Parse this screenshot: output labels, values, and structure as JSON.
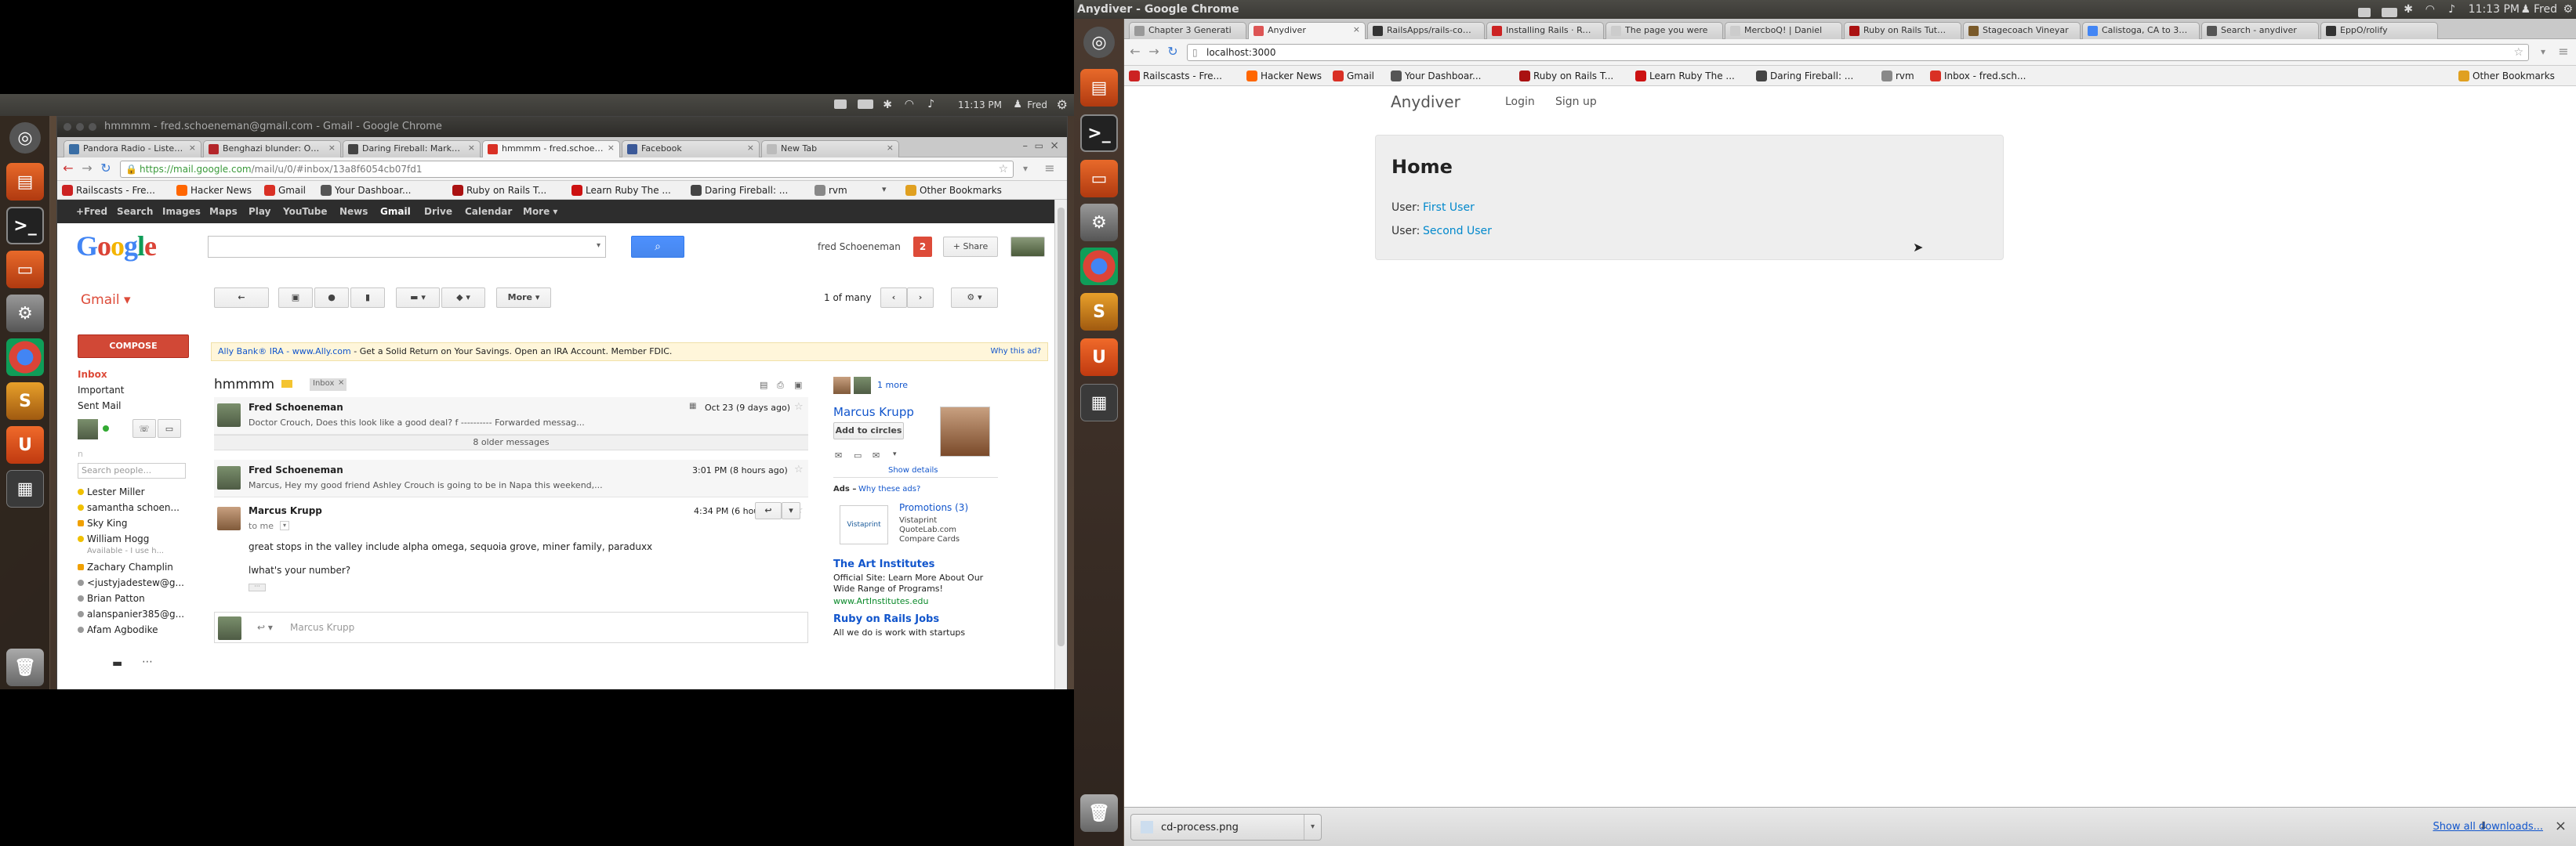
{
  "left_panel": {
    "time": "11:13 PM",
    "user": "Fred"
  },
  "gmail_window": {
    "title": "hmmmm - fred.schoeneman@gmail.com - Gmail - Google Chrome",
    "tabs": [
      {
        "label": "Pandora Radio - Listen to",
        "color": "#3a6ea5"
      },
      {
        "label": "Benghazi blunder: Obam",
        "color": "#b4262a"
      },
      {
        "label": "Daring Fireball: Markdow",
        "color": "#444444"
      },
      {
        "label": "hmmmm - fred.schoenem",
        "color": "#d93025"
      },
      {
        "label": "Facebook",
        "color": "#3b5998"
      },
      {
        "label": "New Tab",
        "color": "#bbbbbb"
      }
    ],
    "url_host": "https://mail.google.com",
    "url_path": "/mail/u/0/#inbox/13a8f6054cb07fd1",
    "bookmarks": [
      {
        "label": "Railscasts - Fre...",
        "color": "#cc2222"
      },
      {
        "label": "Hacker News",
        "color": "#ff6600"
      },
      {
        "label": "Gmail",
        "color": "#d93025"
      },
      {
        "label": "Your Dashboar...",
        "color": "#555555"
      },
      {
        "label": "Ruby on Rails T...",
        "color": "#aa1111"
      },
      {
        "label": "Learn Ruby The ...",
        "color": "#cc1111"
      },
      {
        "label": "Daring Fireball: ...",
        "color": "#444444"
      },
      {
        "label": "rvm",
        "color": "#888888"
      }
    ],
    "other_bookmarks": "Other Bookmarks"
  },
  "gmail": {
    "bar_items": [
      "+Fred",
      "Search",
      "Images",
      "Maps",
      "Play",
      "YouTube",
      "News",
      "Gmail",
      "Drive",
      "Calendar",
      "More ▾"
    ],
    "logo": "Google",
    "user_name": "fred Schoeneman",
    "notif_count": "2",
    "share_label": "+ Share",
    "gmail_label": "Gmail ▾",
    "more_label": "More ▾",
    "pagination": "1 of many",
    "compose": "COMPOSE",
    "nav": [
      "Inbox",
      "Important",
      "Sent Mail"
    ],
    "search_people": "Search people...",
    "contacts": [
      {
        "name": "Lester Miller",
        "status": "#f0c000",
        "sub": ""
      },
      {
        "name": "samantha schoen...",
        "status": "#f0c000",
        "sub": ""
      },
      {
        "name": "Sky King",
        "status": "#f0a000",
        "sub": ""
      },
      {
        "name": "William Hogg",
        "status": "#f0c000",
        "sub": "Available - I use h..."
      },
      {
        "name": "Zachary Champlin",
        "status": "#f0a000",
        "sub": ""
      },
      {
        "name": "<justyjadestew@g...",
        "status": "#999999",
        "sub": ""
      },
      {
        "name": "Brian Patton",
        "status": "#999999",
        "sub": ""
      },
      {
        "name": "alanspanier385@g...",
        "status": "#999999",
        "sub": ""
      },
      {
        "name": "Afam Agbodike",
        "status": "#999999",
        "sub": ""
      }
    ],
    "ad_sponsor": "Ally Bank® IRA - www.Ally.com",
    "ad_text": " - Get a Solid Return on Your Savings. Open an IRA Account. Member FDIC.",
    "why_ad": "Why this ad?",
    "subject": "hmmmm",
    "inbox_tag": "Inbox",
    "messages": [
      {
        "from": "Fred Schoeneman",
        "time": "Oct 23 (9 days ago)",
        "snippet": "Doctor Crouch, Does this look like a good deal? f ---------- Forwarded messag..."
      },
      {
        "from": "Fred Schoeneman",
        "time": "3:01 PM (8 hours ago)",
        "snippet": "Marcus, Hey my good friend Ashley Crouch is going to be in Napa this weekend,..."
      }
    ],
    "older": "8 older messages",
    "open_msg": {
      "from": "Marcus Krupp",
      "time": "4:34 PM (6 hours ago)",
      "to": "to me",
      "body1": "great stops in the valley include alpha omega, sequoia grove, miner family, paraduxx",
      "body2": "lwhat's your number?"
    },
    "reply_to": "Marcus Krupp",
    "side": {
      "more_people": "1 more",
      "person": "Marcus Krupp",
      "add_circles": "Add to circles",
      "show_details": "Show details",
      "ads_label": "Ads –",
      "why_ads": "Why these ads?",
      "ad1_title": "Promotions (3)",
      "ad1_lines": [
        "Vistaprint",
        "QuoteLab.com",
        "Compare Cards"
      ],
      "ad1_logo": "Vistaprint",
      "ad2_title": "The Art Institutes",
      "ad2_text": "Official Site: Learn More About Our Wide Range of Programs!",
      "ad2_url": "www.ArtInstitutes.edu",
      "ad3_title": "Ruby on Rails Jobs",
      "ad3_text": "All we do is work with startups"
    }
  },
  "right_panel": {
    "title": "Anydiver - Google Chrome",
    "time": "11:13 PM",
    "user": "Fred"
  },
  "right_browser": {
    "tabs": [
      {
        "label": "Chapter 3 Generati",
        "color": "#999999"
      },
      {
        "label": "Anydiver",
        "color": "#d55"
      },
      {
        "label": "RailsApps/rails-comp",
        "color": "#333333"
      },
      {
        "label": "Installing Rails · Rails",
        "color": "#cc2222"
      },
      {
        "label": "The page you were",
        "color": "#cccccc"
      },
      {
        "label": "MercboQ! | Daniel",
        "color": "#cccccc"
      },
      {
        "label": "Ruby on Rails Tutoria",
        "color": "#aa1111"
      },
      {
        "label": "Stagecoach Vineyar",
        "color": "#7a5a2a"
      },
      {
        "label": "Calistoga, CA to 328",
        "color": "#4285f4"
      },
      {
        "label": "Search - anydiver",
        "color": "#555555"
      },
      {
        "label": "EppO/rolify",
        "color": "#333333"
      }
    ],
    "url": "localhost:3000",
    "bookmarks": [
      {
        "label": "Railscasts - Fre...",
        "color": "#cc2222"
      },
      {
        "label": "Hacker News",
        "color": "#ff6600"
      },
      {
        "label": "Gmail",
        "color": "#d93025"
      },
      {
        "label": "Your Dashboar...",
        "color": "#555555"
      },
      {
        "label": "Ruby on Rails T...",
        "color": "#aa1111"
      },
      {
        "label": "Learn Ruby The ...",
        "color": "#cc1111"
      },
      {
        "label": "Daring Fireball: ...",
        "color": "#444444"
      },
      {
        "label": "rvm",
        "color": "#888888"
      },
      {
        "label": "Inbox - fred.sch...",
        "color": "#d93025"
      }
    ],
    "other_bookmarks": "Other Bookmarks"
  },
  "anydiver": {
    "brand": "Anydiver",
    "nav": [
      "Login",
      "Sign up"
    ],
    "heading": "Home",
    "users": [
      {
        "label": "User:",
        "name": "First User"
      },
      {
        "label": "User:",
        "name": "Second User"
      }
    ]
  },
  "download_bar": {
    "file": "cd-process.png",
    "show_all": "Show all downloads..."
  }
}
